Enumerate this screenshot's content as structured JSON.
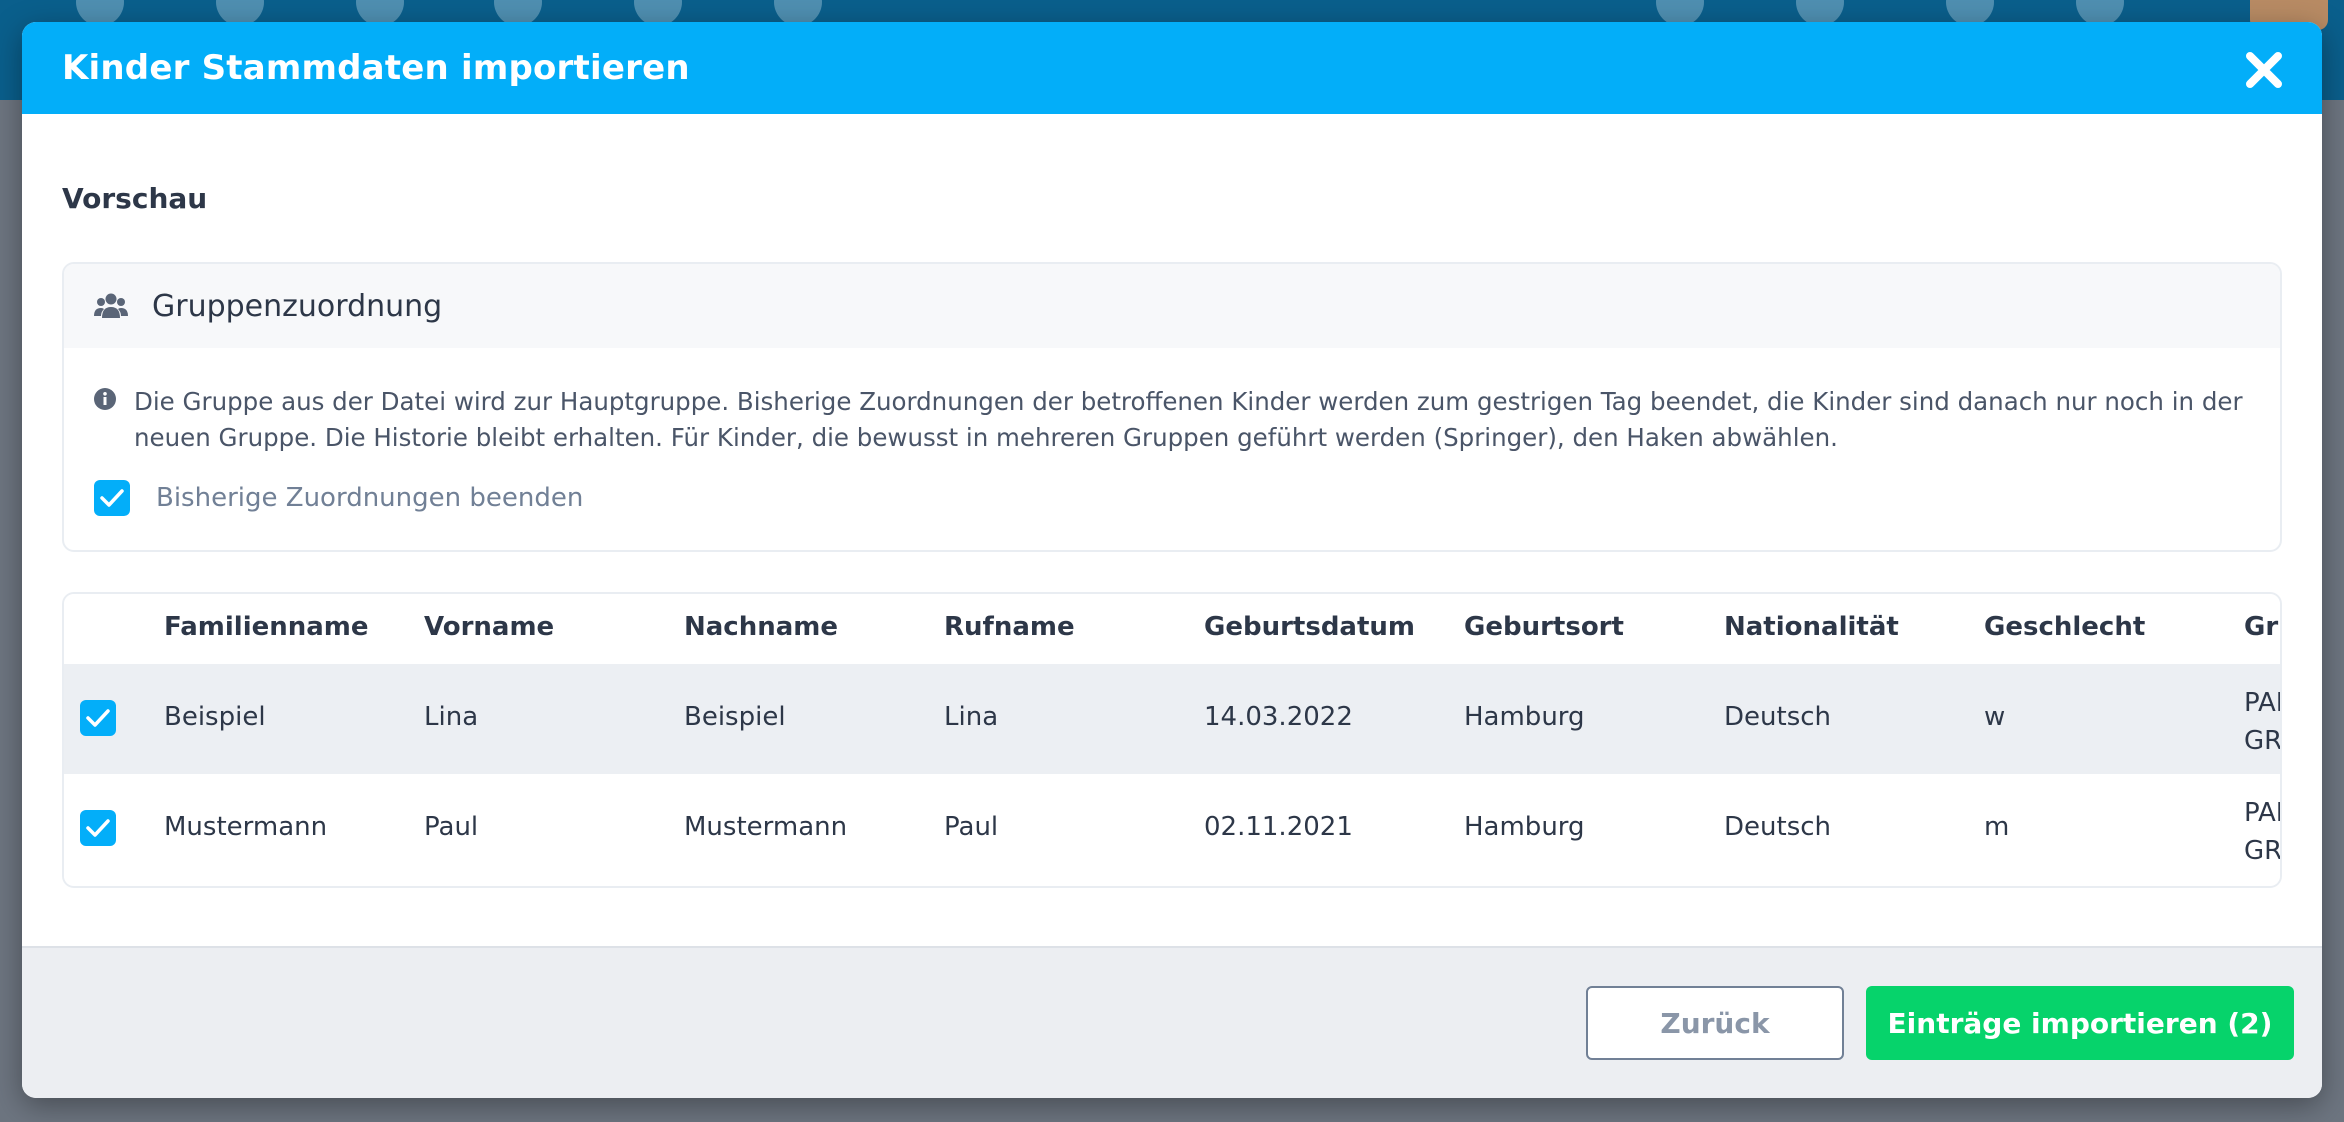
{
  "background": {
    "accent": "#0a5f8c"
  },
  "modal": {
    "title": "Kinder Stammdaten importieren",
    "close_icon": "close-icon",
    "section_title": "Vorschau",
    "group_card": {
      "title": "Gruppenzuordnung",
      "icon": "users-icon",
      "info_icon": "info-icon",
      "info_line1": "Die Gruppe aus der Datei wird zur Hauptgruppe. Bisherige Zuordnungen der betroffenen Kinder werden zum gestrigen Tag beendet, die Kinder sind danach nur noch in der",
      "info_line2": "neuen Gruppe. Die Historie bleibt erhalten. Für Kinder, die bewusst in mehreren Gruppen geführt werden (Springer), den Haken abwählen.",
      "end_assignments_label": "Bisherige Zuordnungen beenden",
      "end_assignments_checked": true
    },
    "table": {
      "columns": [
        "Familienname",
        "Vorname",
        "Nachname",
        "Rufname",
        "Geburtsdatum",
        "Geburtsort",
        "Nationalität",
        "Geschlecht",
        "Gru"
      ],
      "rows": [
        {
          "checked": true,
          "cells": [
            "Beispiel",
            "Lina",
            "Beispiel",
            "Lina",
            "14.03.2022",
            "Hamburg",
            "Deutsch",
            "w"
          ],
          "group_line1": "PAI",
          "group_line2": "GR"
        },
        {
          "checked": true,
          "cells": [
            "Mustermann",
            "Paul",
            "Mustermann",
            "Paul",
            "02.11.2021",
            "Hamburg",
            "Deutsch",
            "m"
          ],
          "group_line1": "PAI",
          "group_line2": "GR"
        }
      ]
    },
    "footer": {
      "back_label": "Zurück",
      "import_label": "Einträge importieren (2)"
    },
    "colors": {
      "header": "#03aef9",
      "import_button": "#06d36b",
      "checkbox": "#03aef9"
    }
  }
}
